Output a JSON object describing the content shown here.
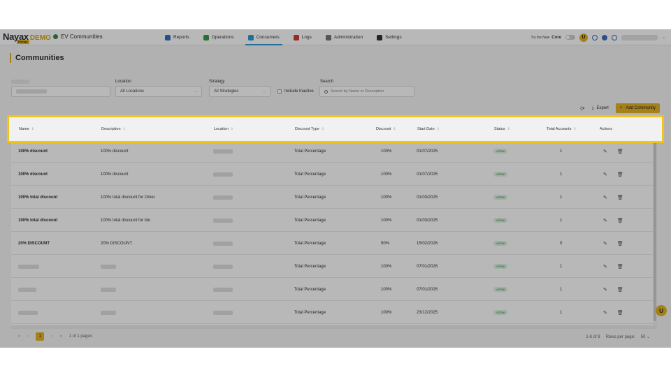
{
  "brand": {
    "logo": "Nayax",
    "demo": "DEMO",
    "badge": "Energy"
  },
  "tenant": "EV Communities",
  "nav": [
    {
      "label": "Reports",
      "color": "#3a6ec1"
    },
    {
      "label": "Operations",
      "color": "#3a9a4a"
    },
    {
      "label": "Consumers",
      "color": "#2e9bd6",
      "active": true
    },
    {
      "label": "Logs",
      "color": "#d23a3a"
    },
    {
      "label": "Administration",
      "color": "#777777"
    },
    {
      "label": "Settings",
      "color": "#333333"
    }
  ],
  "topright": {
    "try_prefix": "Try the New",
    "try_brand": "Core"
  },
  "page": {
    "title": "Communities"
  },
  "filters": {
    "location_label": "Location",
    "location_value": "All Locations",
    "strategy_label": "Strategy",
    "strategy_value": "All Strategies",
    "include_inactive": "Include Inactive",
    "search_label": "Search",
    "search_placeholder": "Search by Name or Description"
  },
  "tools": {
    "export": "Export",
    "add": "Add Community"
  },
  "table": {
    "columns": [
      "Name",
      "Description",
      "Location",
      "Discount Type",
      "Discount",
      "Start Date",
      "Status",
      "Total Accounts",
      "Actions"
    ],
    "rows": [
      {
        "name": "100% discount",
        "description": "100% discount",
        "type": "Total Percentage",
        "discount": "100%",
        "start": "01/07/2025",
        "status": "Active",
        "accounts": "1"
      },
      {
        "name": "100% discount",
        "description": "100% discount",
        "type": "Total Percentage",
        "discount": "100%",
        "start": "01/07/2025",
        "status": "Active",
        "accounts": "1"
      },
      {
        "name": "100% total discount",
        "description": "100% total discount for Omer",
        "type": "Total Percentage",
        "discount": "100%",
        "start": "01/03/2025",
        "status": "Active",
        "accounts": "1"
      },
      {
        "name": "100% total discount",
        "description": "100% total discount for Ido",
        "type": "Total Percentage",
        "discount": "100%",
        "start": "01/03/2025",
        "status": "Active",
        "accounts": "1"
      },
      {
        "name": "20% DISCOUNT",
        "description": "20% DISCOUNT",
        "type": "Total Percentage",
        "discount": "50%",
        "start": "15/02/2026",
        "status": "Active",
        "accounts": "0"
      },
      {
        "name": "",
        "description": "",
        "type": "Total Percentage",
        "discount": "100%",
        "start": "07/01/2026",
        "status": "Active",
        "accounts": "1"
      },
      {
        "name": "",
        "description": "",
        "type": "Total Percentage",
        "discount": "100%",
        "start": "07/01/2026",
        "status": "Active",
        "accounts": "1"
      },
      {
        "name": "",
        "description": "",
        "type": "Total Percentage",
        "discount": "100%",
        "start": "23/12/2025",
        "status": "Active",
        "accounts": "1"
      }
    ]
  },
  "pager": {
    "current": "1",
    "of_pages": "1 of 1 pages",
    "range": "1-8 of 8",
    "rows_label": "Rows per page:",
    "rows_value": "50"
  }
}
